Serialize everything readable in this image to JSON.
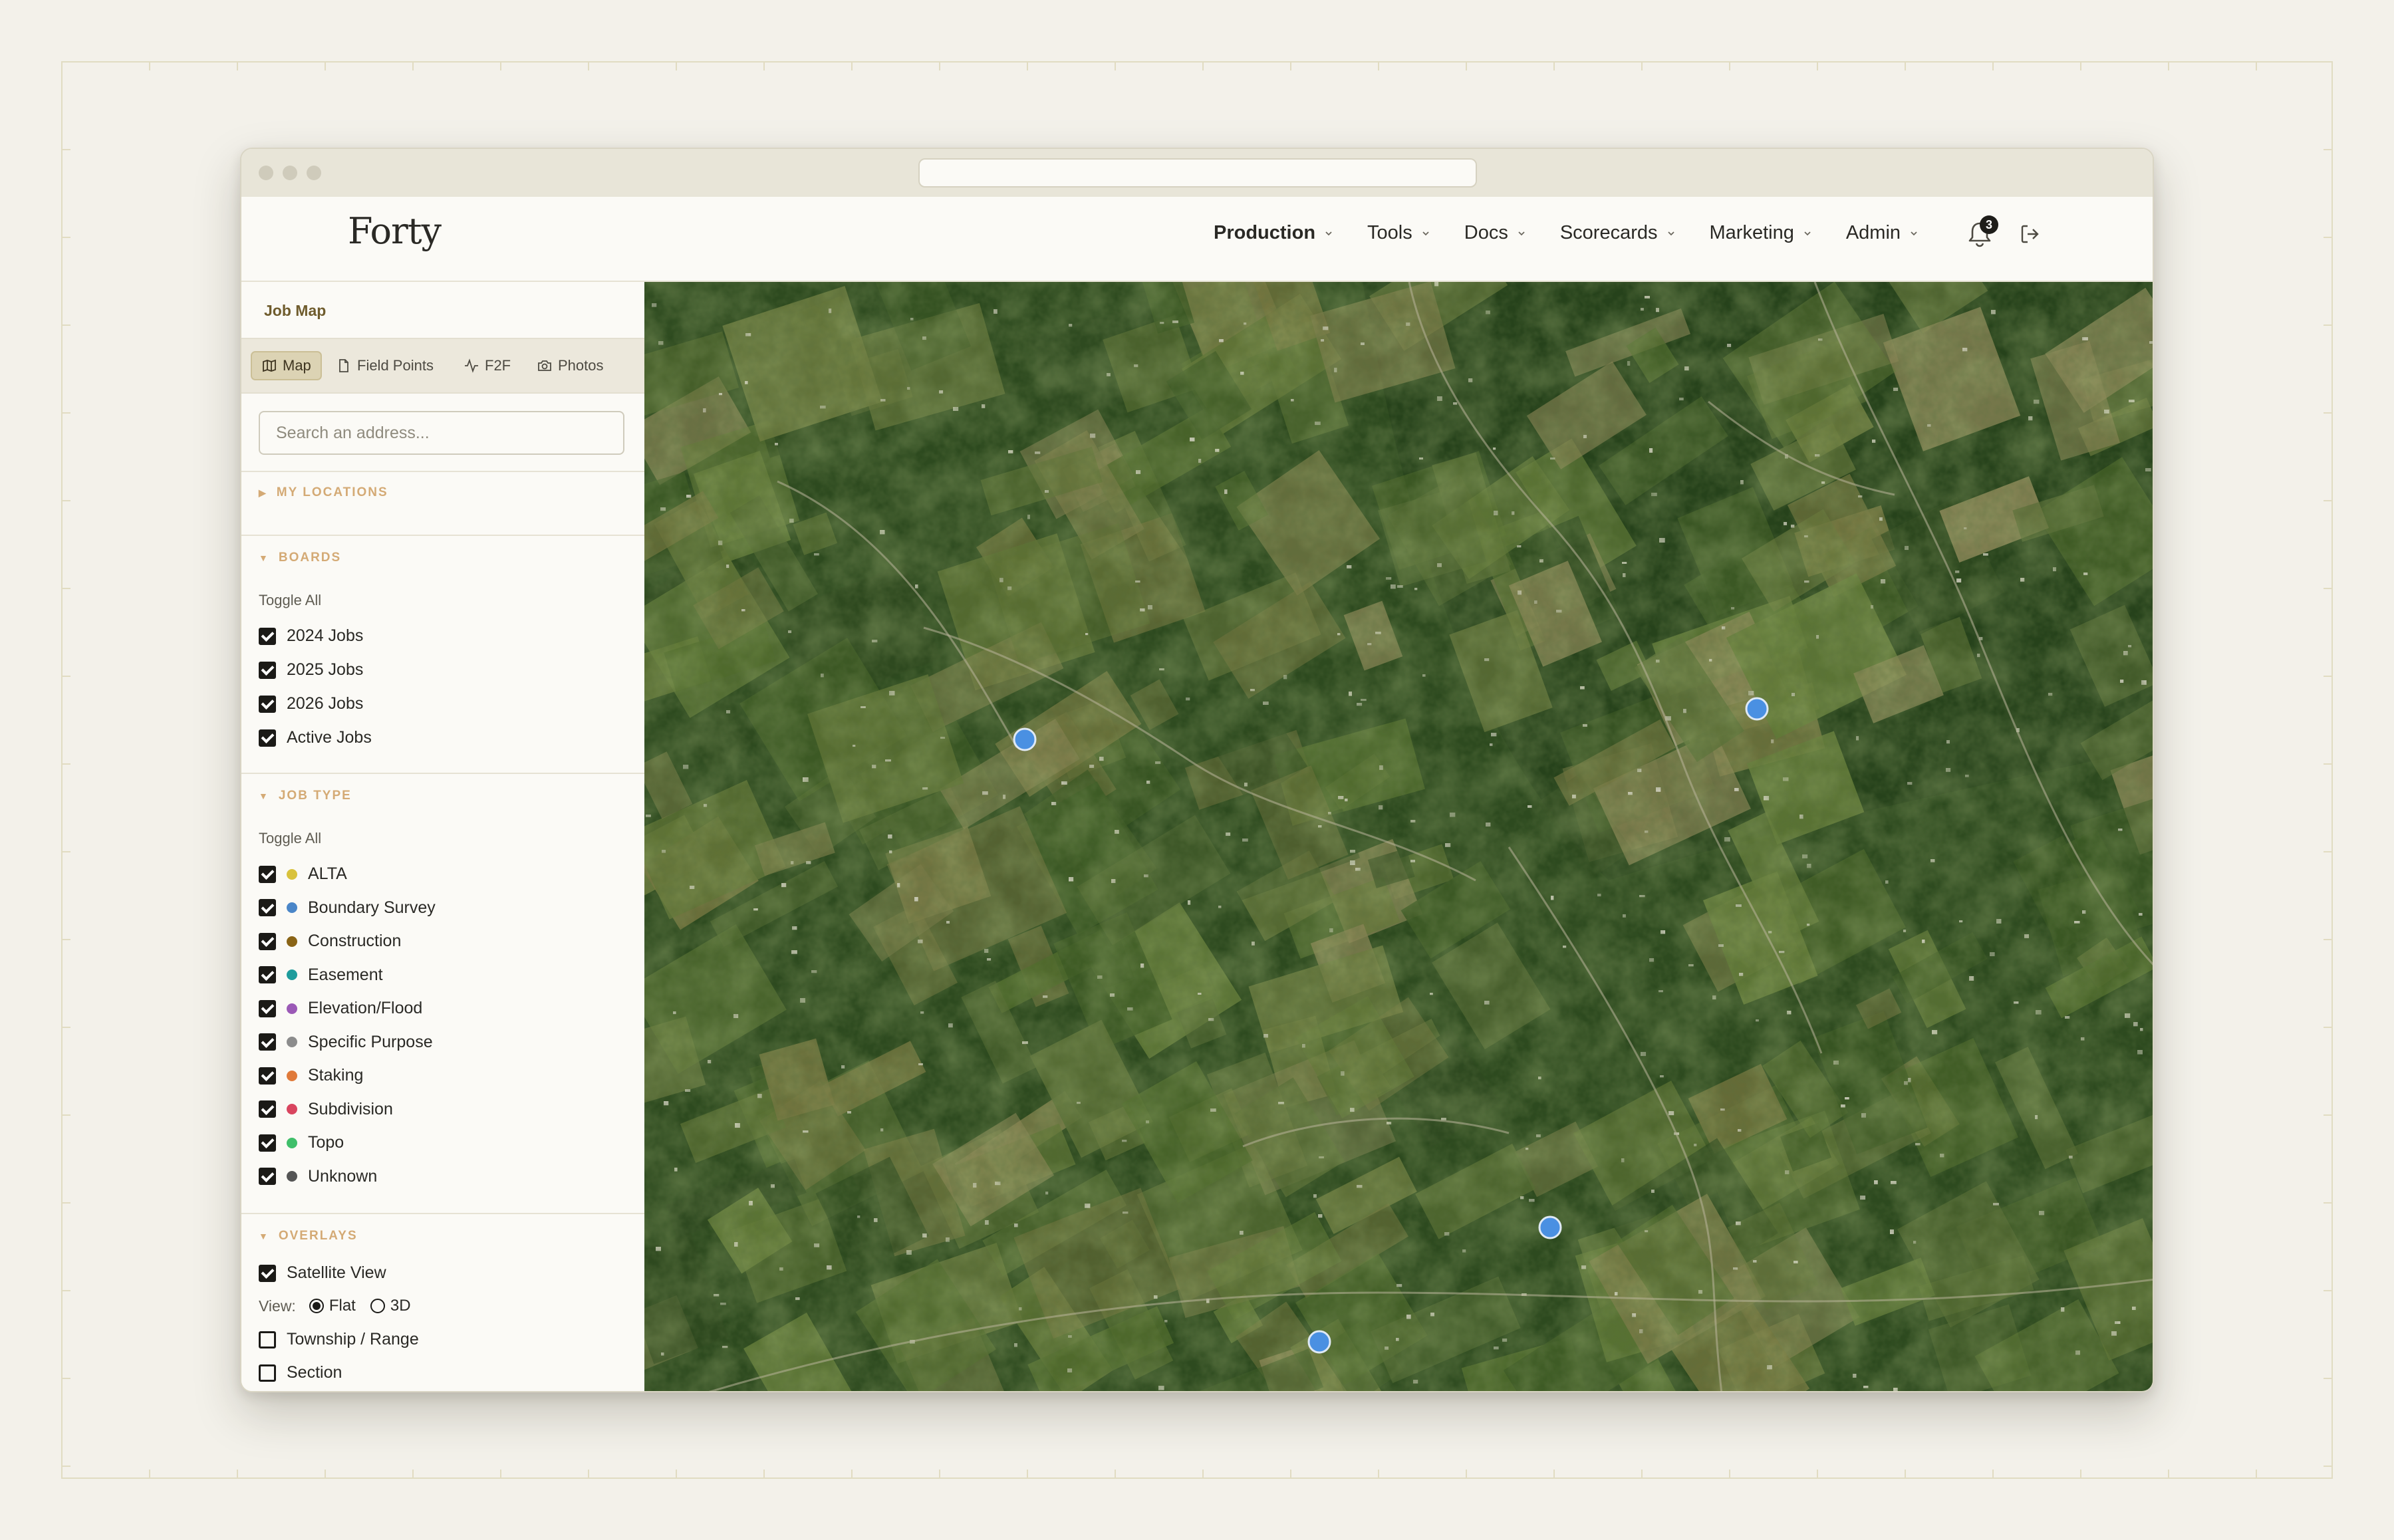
{
  "app": {
    "logo": "Forty",
    "notifications_count": "3"
  },
  "nav": [
    {
      "label": "Production",
      "active": true
    },
    {
      "label": "Tools"
    },
    {
      "label": "Docs"
    },
    {
      "label": "Scorecards"
    },
    {
      "label": "Marketing"
    },
    {
      "label": "Admin"
    }
  ],
  "sidebar": {
    "title": "Job Map",
    "tabs": [
      {
        "label": "Map",
        "icon": "map-icon",
        "active": true
      },
      {
        "label": "Field Points",
        "icon": "file-icon"
      },
      {
        "label": "F2F",
        "icon": "activity-icon"
      },
      {
        "label": "Photos",
        "icon": "camera-icon"
      }
    ],
    "search": {
      "placeholder": "Search an address..."
    },
    "my_locations": {
      "label": "MY LOCATIONS",
      "expanded": false
    },
    "boards": {
      "label": "BOARDS",
      "toggle_all": "Toggle All",
      "items": [
        {
          "label": "2024 Jobs",
          "checked": true
        },
        {
          "label": "2025 Jobs",
          "checked": true
        },
        {
          "label": "2026 Jobs",
          "checked": true
        },
        {
          "label": "Active Jobs",
          "checked": true
        }
      ]
    },
    "job_type": {
      "label": "JOB TYPE",
      "toggle_all": "Toggle All",
      "items": [
        {
          "label": "ALTA",
          "color": "#d9c23c",
          "checked": true
        },
        {
          "label": "Boundary Survey",
          "color": "#4a86c8",
          "checked": true
        },
        {
          "label": "Construction",
          "color": "#8a6416",
          "checked": true
        },
        {
          "label": "Easement",
          "color": "#1e9c9c",
          "checked": true
        },
        {
          "label": "Elevation/Flood",
          "color": "#9b59b6",
          "checked": true
        },
        {
          "label": "Specific Purpose",
          "color": "#8c8c8c",
          "checked": true
        },
        {
          "label": "Staking",
          "color": "#e07a3a",
          "checked": true
        },
        {
          "label": "Subdivision",
          "color": "#d9455f",
          "checked": true
        },
        {
          "label": "Topo",
          "color": "#3fbf6a",
          "checked": true
        },
        {
          "label": "Unknown",
          "color": "#555555",
          "checked": true
        }
      ]
    },
    "overlays": {
      "label": "OVERLAYS",
      "satellite": {
        "label": "Satellite View",
        "checked": true
      },
      "view_label": "View:",
      "view_options": [
        {
          "label": "Flat",
          "selected": true
        },
        {
          "label": "3D",
          "selected": false
        }
      ],
      "township": {
        "label": "Township / Range",
        "checked": false
      },
      "section": {
        "label": "Section",
        "checked": false
      }
    }
  },
  "map": {
    "job_pin_color": "#4a90e2",
    "jobs": [
      {
        "type": "Boundary Survey"
      },
      {
        "type": "Boundary Survey"
      },
      {
        "type": "Boundary Survey"
      },
      {
        "type": "Boundary Survey"
      }
    ]
  }
}
